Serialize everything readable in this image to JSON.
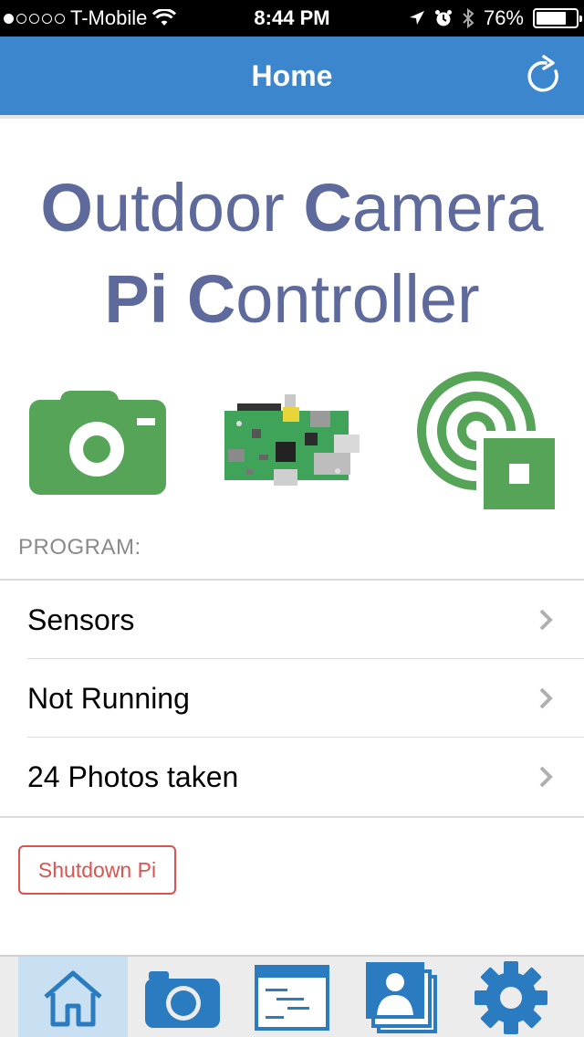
{
  "status_bar": {
    "carrier": "T-Mobile",
    "time": "8:44 PM",
    "battery_percent": "76%",
    "battery_level": 0.76,
    "signal_bars": 1
  },
  "nav": {
    "title": "Home",
    "refresh_icon": "refresh-icon"
  },
  "app_title": {
    "line1": [
      {
        "initial": "O",
        "rest": "utdoor"
      },
      {
        "initial": "C",
        "rest": "amera"
      }
    ],
    "line2": [
      {
        "initial": "Pi",
        "rest": ""
      },
      {
        "initial": "C",
        "rest": "ontroller"
      }
    ]
  },
  "features": [
    {
      "name": "camera-icon"
    },
    {
      "name": "raspberry-pi-board-icon"
    },
    {
      "name": "sensor-signal-icon"
    }
  ],
  "program": {
    "section_label": "PROGRAM:",
    "items": [
      {
        "label": "Sensors"
      },
      {
        "label": "Not Running"
      },
      {
        "label": "24 Photos taken"
      }
    ]
  },
  "shutdown_label": "Shutdown Pi",
  "tabs": [
    {
      "name": "home-icon",
      "active": true
    },
    {
      "name": "camera-icon",
      "active": false
    },
    {
      "name": "log-window-icon",
      "active": false
    },
    {
      "name": "photo-gallery-icon",
      "active": false
    },
    {
      "name": "settings-gear-icon",
      "active": false
    }
  ],
  "colors": {
    "nav_bg": "#3c86cd",
    "title_text": "#5e6a9b",
    "icon_green": "#55a457",
    "tab_icon_blue": "#2a7bc0",
    "danger": "#d9534f"
  }
}
